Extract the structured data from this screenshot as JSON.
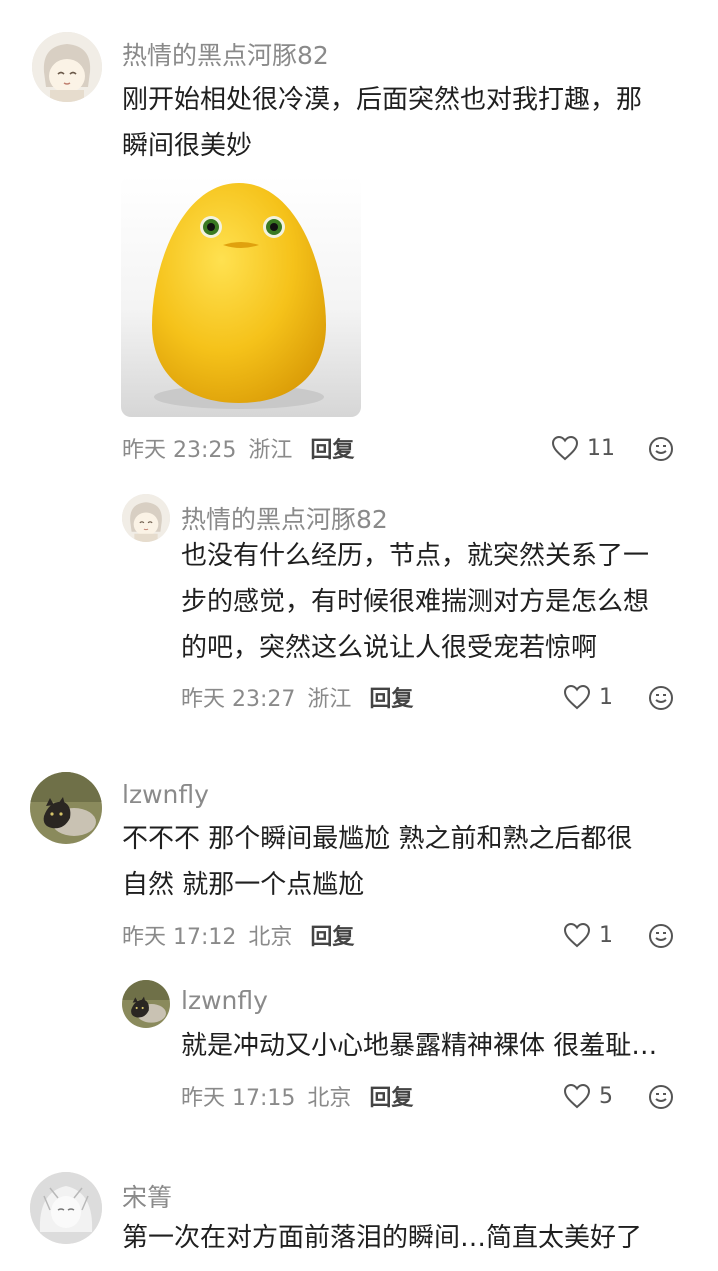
{
  "comments": [
    {
      "username": "热情的黑点河豚82",
      "text_line1": "刚开始相处很冷漠，后面突然也对我打趣，那",
      "text_line2": "瞬间很美妙",
      "time": "昨天 23:25",
      "location": "浙江",
      "reply_label": "回复",
      "likes": "11",
      "replies": [
        {
          "username": "热情的黑点河豚82",
          "text_line1": "也没有什么经历，节点，就突然关系了一",
          "text_line2": "步的感觉，有时候很难揣测对方是怎么想",
          "text_line3": "的吧，突然这么说让人很受宠若惊啊",
          "time": "昨天 23:27",
          "location": "浙江",
          "reply_label": "回复",
          "likes": "1"
        }
      ]
    },
    {
      "username": "lzwnfly",
      "text_line1": "不不不 那个瞬间最尴尬 熟之前和熟之后都很",
      "text_line2": "自然 就那一个点尴尬",
      "time": "昨天 17:12",
      "location": "北京",
      "reply_label": "回复",
      "likes": "1",
      "replies": [
        {
          "username": "lzwnfly",
          "text_line1": "就是冲动又小心地暴露精神裸体 很羞耻…",
          "time": "昨天 17:15",
          "location": "北京",
          "reply_label": "回复",
          "likes": "5"
        }
      ]
    },
    {
      "username": "宋箐",
      "text_line1": "第一次在对方面前落泪的瞬间…简直太美好了"
    }
  ],
  "colors": {
    "meta_gray": "#8a8a8a",
    "text_dark": "#1f1f1f",
    "sticker_yellow": "#f5c21a"
  },
  "icons": {
    "like": "heart-outline-icon",
    "emoji": "emoji-smile-icon"
  }
}
